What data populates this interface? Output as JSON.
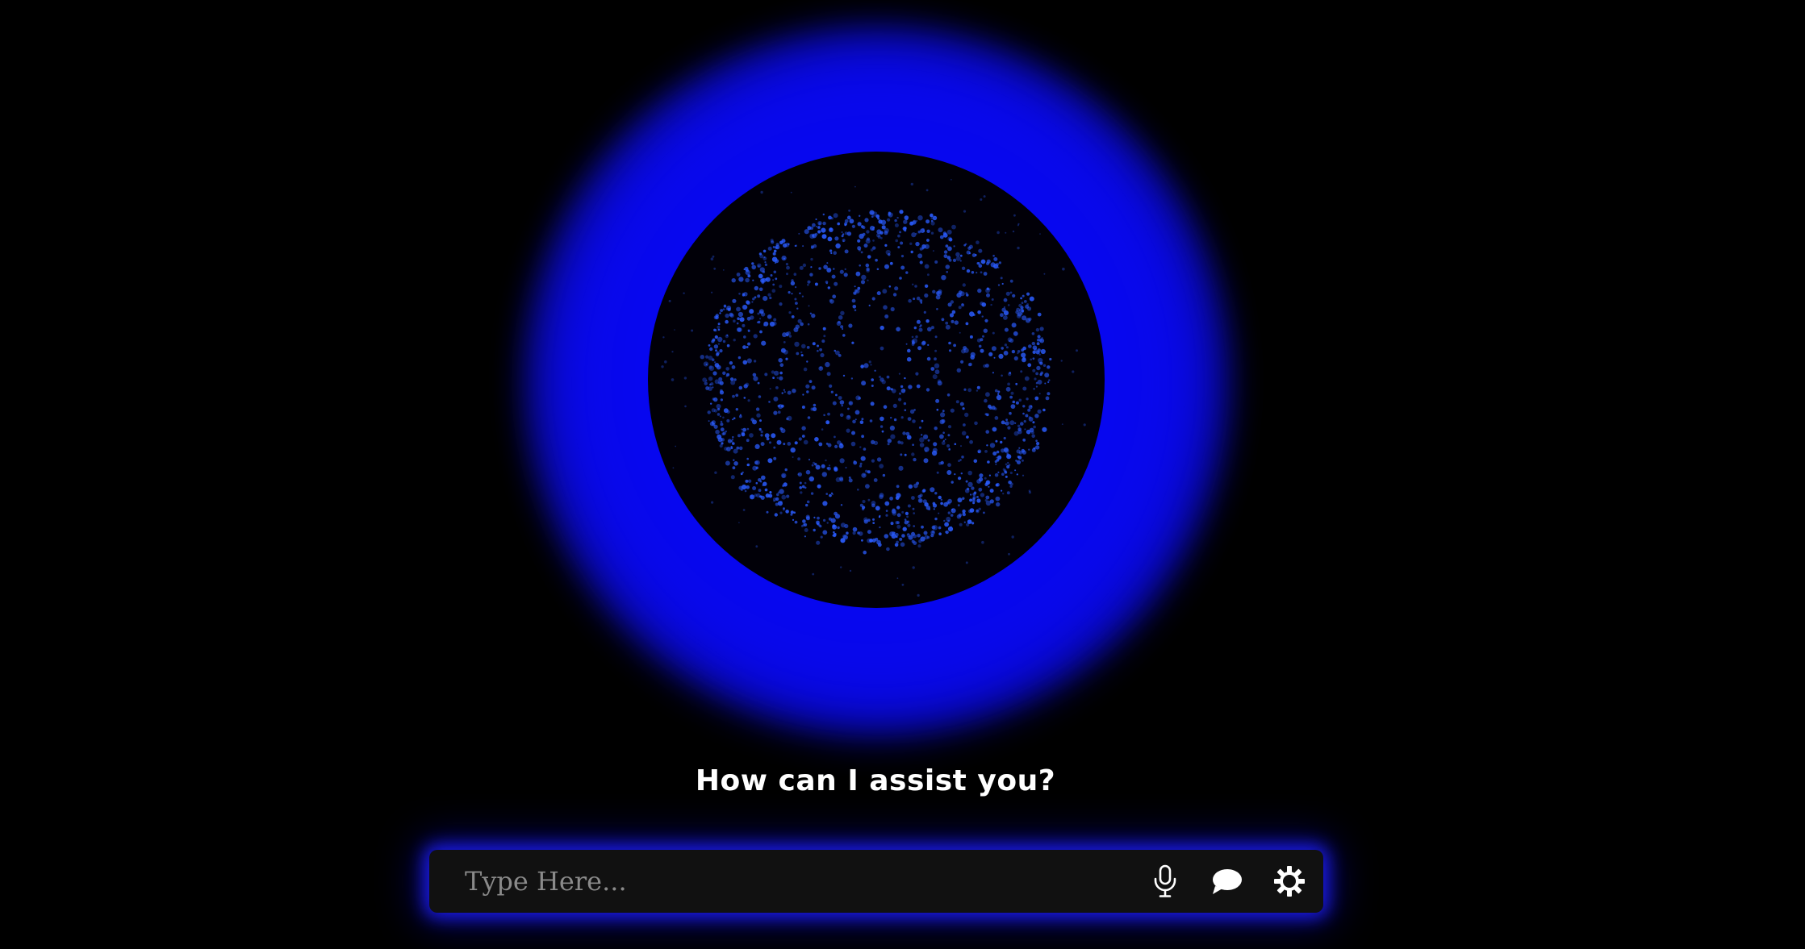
{
  "prompt": {
    "heading": "How can I assist you?"
  },
  "input": {
    "placeholder": "Type Here...",
    "value": ""
  },
  "controls": [
    {
      "name": "microphone-icon"
    },
    {
      "name": "chat-bubble-icon"
    },
    {
      "name": "gear-icon"
    }
  ],
  "theme": {
    "background": "#000000",
    "glow": "#0000ff",
    "particle": "#2a5cff",
    "bar": "#111111",
    "text": "#ffffff"
  }
}
